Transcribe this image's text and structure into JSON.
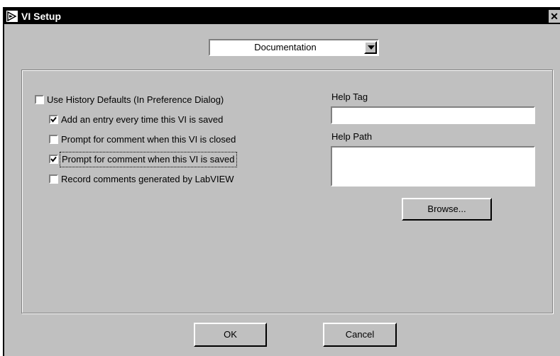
{
  "window": {
    "title": "VI Setup",
    "close_glyph": "✕"
  },
  "category_select": {
    "value": "Documentation"
  },
  "history": {
    "use_defaults": {
      "label": "Use History Defaults (In Preference Dialog)",
      "checked": false
    },
    "options": [
      {
        "label": "Add an entry every time this VI is saved",
        "checked": true
      },
      {
        "label": "Prompt for comment when this VI is closed",
        "checked": false
      },
      {
        "label": "Prompt for comment when this VI is saved",
        "checked": true
      },
      {
        "label": "Record comments generated by LabVIEW",
        "checked": false
      }
    ]
  },
  "help": {
    "tag_label": "Help Tag",
    "tag_value": "",
    "path_label": "Help Path",
    "path_value": "",
    "browse_label": "Browse..."
  },
  "buttons": {
    "ok_label": "OK",
    "cancel_label": "Cancel"
  }
}
